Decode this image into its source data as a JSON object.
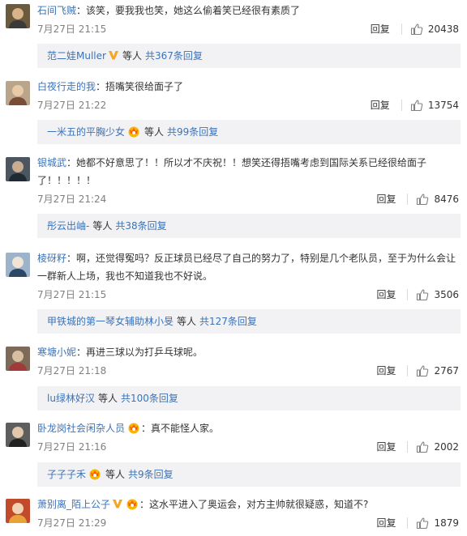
{
  "colors": {
    "username": "#eb7350",
    "link": "#3b73b8",
    "meta": "#808080",
    "subbox_bg": "#f2f2f5"
  },
  "labels": {
    "reply": "回复",
    "sep": "："
  },
  "comments": [
    {
      "user": "石间飞贼",
      "lines": [
        "该笑，要我我也笑，她这么偷着笑已经很有素质了"
      ],
      "time": "7月27日 21:15",
      "likes": "20438",
      "sub_user": "范二娃Muller",
      "sub_badge": "verified-v-icon",
      "sub_etc": "等人",
      "sub_total": "共367条回复"
    },
    {
      "user": "白夜行走的我",
      "lines": [
        "捂嘴笑很给面子了"
      ],
      "time": "7月27日 21:22",
      "likes": "13754",
      "sub_user": "一米五的平胸少女",
      "sub_badge": "member-crown-icon",
      "sub_etc": "等人",
      "sub_total": "共99条回复"
    },
    {
      "user": "银城武",
      "lines": [
        "她都不好意思了！！所以才不庆祝！！想笑还得捂嘴考虑到国际关系已经很给面子",
        "了！！！！！"
      ],
      "time": "7月27日 21:24",
      "likes": "8476",
      "sub_user": "彤云出岫-",
      "sub_badge": "",
      "sub_etc": "等人",
      "sub_total": "共38条回复"
    },
    {
      "user": "棱砑籽",
      "lines": [
        "啊，还觉得冤吗？反正球员已经尽了自己的努力了，特别是几个老队员，至于为什么会让",
        "一群新人上场，我也不知道我也不好说。"
      ],
      "time": "7月27日 21:15",
      "likes": "3506",
      "sub_user": "甲铁城的第一琴女辅助林小旻",
      "sub_badge": "",
      "sub_etc": "等人",
      "sub_total": "共127条回复"
    },
    {
      "user": "寒塘小妮",
      "lines": [
        "再进三球以为打乒乓球呢。"
      ],
      "time": "7月27日 21:18",
      "likes": "2767",
      "sub_user": "lu绿林好汉",
      "sub_badge": "",
      "sub_etc": "等人",
      "sub_total": "共100条回复"
    },
    {
      "user": "卧龙岗社会闲杂人员",
      "user_badge": "member-crown-icon",
      "lines": [
        "真不能怪人家。"
      ],
      "time": "7月27日 21:16",
      "likes": "2002",
      "sub_user": "子子子禾",
      "sub_badge": "member-crown-icon",
      "sub_etc": "等人",
      "sub_total": "共9条回复"
    },
    {
      "user": "萧别离_陌上公子",
      "user_badge": "verified-v-icon",
      "user_badge2": "member-crown-icon",
      "lines": [
        "这水平进入了奥运会，对方主帅就很疑惑，知道不?"
      ],
      "time": "7月27日 21:29",
      "likes": "1879"
    }
  ]
}
